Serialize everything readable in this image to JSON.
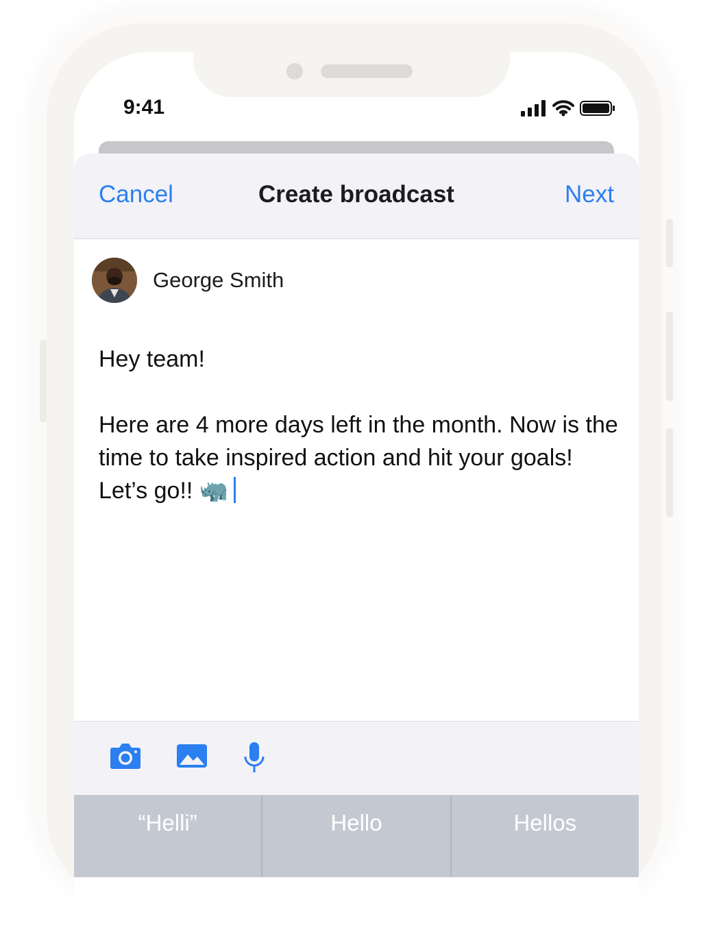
{
  "status": {
    "time": "9:41"
  },
  "nav": {
    "cancel": "Cancel",
    "title": "Create broadcast",
    "next": "Next"
  },
  "author": {
    "name": "George Smith"
  },
  "message": {
    "line1": "Hey team!",
    "body": "Here are 4 more days left in the month. Now is the time to take inspired action and hit your goals! Let’s go!! 🦏"
  },
  "toolbar": {
    "icons": [
      "camera-icon",
      "photo-icon",
      "microphone-icon"
    ]
  },
  "suggestions": [
    "“Helli”",
    "Hello",
    "Hellos"
  ],
  "colors": {
    "accent": "#2b7ff0",
    "navbar_bg": "#f2f2f7",
    "suggestion_bar": "#c4c9d1"
  }
}
